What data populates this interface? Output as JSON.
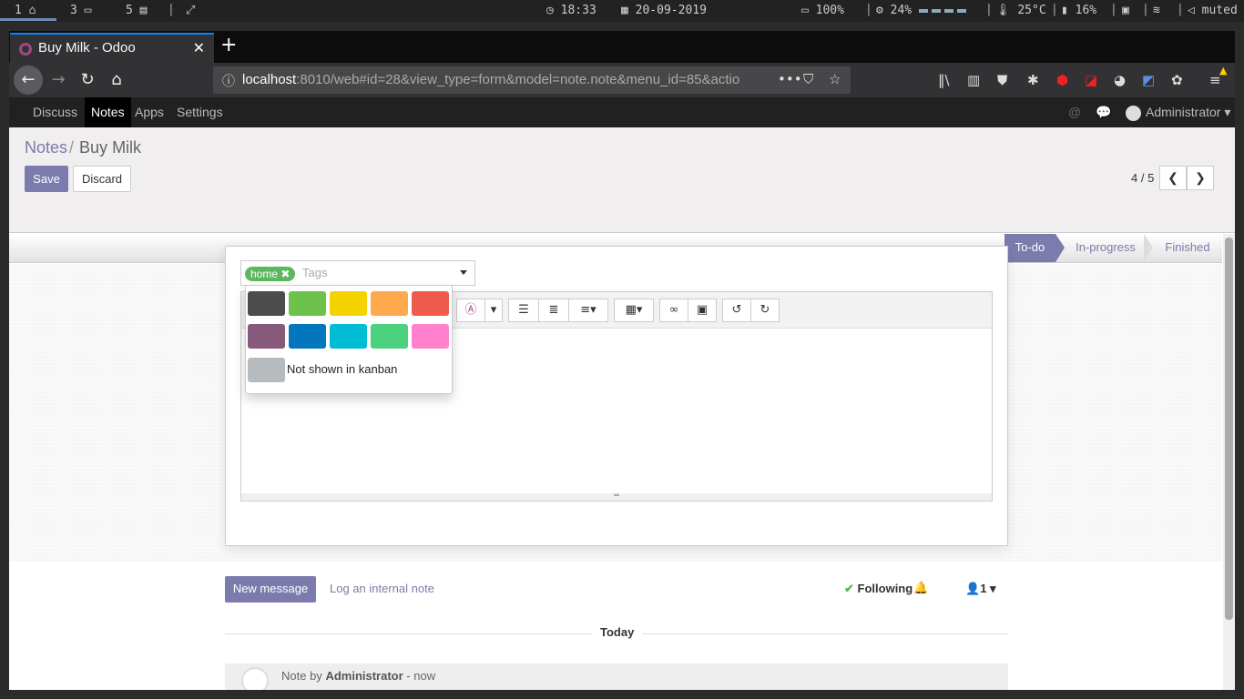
{
  "desktop": {
    "workspaces": [
      "1",
      "3",
      "5"
    ],
    "time": "18:33",
    "date": "20-09-2019",
    "battery": "100%",
    "cpu": "24%",
    "temp": "25°C",
    "memory": "16%",
    "volume": "muted"
  },
  "browser": {
    "tab_title": "Buy Milk - Odoo",
    "url_host": "localhost",
    "url_rest": ":8010/web#id=28&view_type=form&model=note.note&menu_id=85&actio",
    "accent": "#0a84ff"
  },
  "odoo": {
    "menu": [
      "Discuss",
      "Notes",
      "Apps",
      "Settings"
    ],
    "active_menu": "Notes",
    "user": "Administrator",
    "brand_color": "#7c7bad"
  },
  "breadcrumb": {
    "parent": "Notes",
    "current": "Buy Milk"
  },
  "buttons": {
    "save": "Save",
    "discard": "Discard"
  },
  "pager": {
    "value": "4 / 5"
  },
  "stages": [
    "To-do",
    "In-progress",
    "Finished"
  ],
  "active_stage": "To-do",
  "tags": {
    "selected": "home",
    "selected_color": "#5cb85c",
    "placeholder": "Tags"
  },
  "color_picker": {
    "colors": [
      "#4c4c4c",
      "#6cc24a",
      "#f4d300",
      "#ffa94d",
      "#ef5c4e",
      "#875a7b",
      "#0277bd",
      "#00bcd4",
      "#4cd27f",
      "#ff80cc"
    ],
    "no_kanban_color": "#b6bbbf",
    "no_kanban_label": "Not shown in kanban"
  },
  "chatter": {
    "new_message": "New message",
    "log_note": "Log an internal note",
    "following": "Following",
    "followers_count": "1",
    "today": "Today",
    "note_prefix": "Note by",
    "note_author": "Administrator",
    "note_time": "- now"
  }
}
